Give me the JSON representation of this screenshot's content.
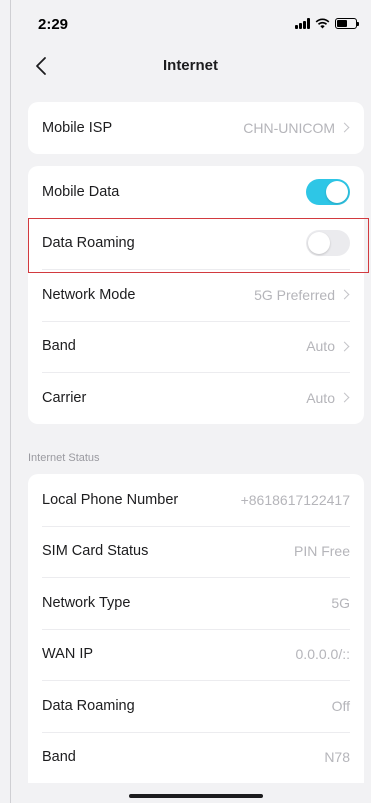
{
  "status_bar": {
    "time": "2:29"
  },
  "nav": {
    "title": "Internet"
  },
  "isp_card": {
    "label": "Mobile ISP",
    "value": "CHN-UNICOM"
  },
  "settings_card": {
    "mobile_data": {
      "label": "Mobile Data",
      "enabled": true
    },
    "data_roaming": {
      "label": "Data Roaming",
      "enabled": false
    },
    "network_mode": {
      "label": "Network Mode",
      "value": "5G Preferred"
    },
    "band": {
      "label": "Band",
      "value": "Auto"
    },
    "carrier": {
      "label": "Carrier",
      "value": "Auto"
    }
  },
  "internet_status": {
    "section_title": "Internet Status",
    "rows": [
      {
        "label": "Local Phone Number",
        "value": "+8618617122417"
      },
      {
        "label": "SIM Card Status",
        "value": "PIN Free"
      },
      {
        "label": "Network Type",
        "value": "5G"
      },
      {
        "label": "WAN IP",
        "value": "0.0.0.0/::"
      },
      {
        "label": "Data Roaming",
        "value": "Off"
      },
      {
        "label": "Band",
        "value": "N78"
      }
    ]
  },
  "colors": {
    "accent": "#2ec6e6",
    "highlight": "#d23a3f"
  }
}
